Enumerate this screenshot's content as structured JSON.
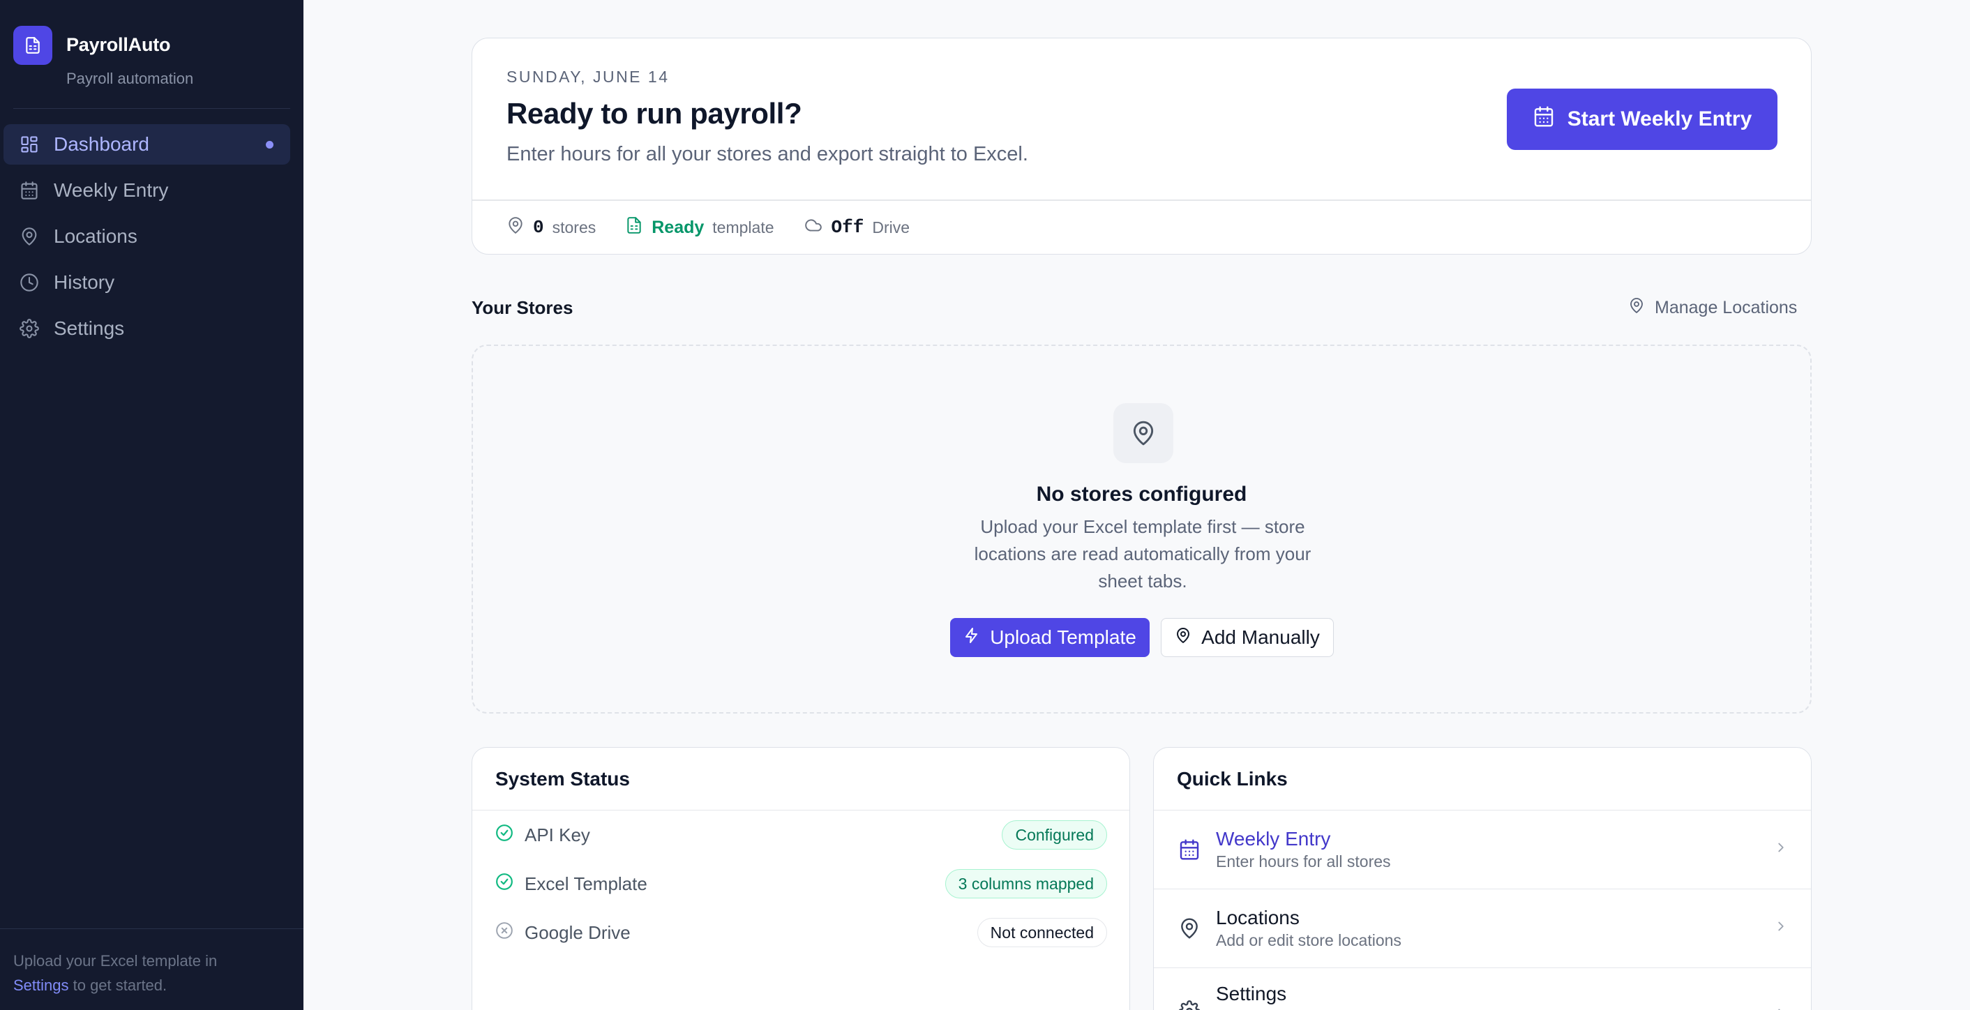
{
  "sidebar": {
    "brand_name": "PayrollAuto",
    "brand_sub": "Payroll automation",
    "items": [
      {
        "label": "Dashboard",
        "icon": "dashboard-icon",
        "active": true
      },
      {
        "label": "Weekly Entry",
        "icon": "calendar-icon"
      },
      {
        "label": "Locations",
        "icon": "map-pin-icon"
      },
      {
        "label": "History",
        "icon": "clock-icon"
      },
      {
        "label": "Settings",
        "icon": "gear-icon"
      }
    ],
    "footer": {
      "before": "Upload your Excel template in",
      "link": "Settings",
      "after": " to get started."
    }
  },
  "hero": {
    "date": "SUNDAY, JUNE 14",
    "title": "Ready to run payroll?",
    "subtitle": "Enter hours for all your stores and export straight to Excel.",
    "cta_label": "Start Weekly Entry",
    "stats": {
      "stores_value": "0",
      "stores_label": "stores",
      "template_value": "Ready",
      "template_label": "template",
      "drive_value": "Off",
      "drive_label": "Drive"
    }
  },
  "stores": {
    "title": "Your Stores",
    "manage_label": "Manage Locations",
    "empty_title": "No stores configured",
    "empty_desc": "Upload your Excel template first — store locations are read automatically from your sheet tabs.",
    "upload_label": "Upload Template",
    "add_label": "Add Manually"
  },
  "system_status": {
    "title": "System Status",
    "rows": [
      {
        "label": "API Key",
        "badge": "Configured",
        "state": "ok"
      },
      {
        "label": "Excel Template",
        "badge": "3 columns mapped",
        "state": "ok"
      },
      {
        "label": "Google Drive",
        "badge": "Not connected",
        "state": "off"
      }
    ]
  },
  "quick_links": {
    "title": "Quick Links",
    "items": [
      {
        "title": "Weekly Entry",
        "desc": "Enter hours for all stores",
        "icon": "calendar-icon"
      },
      {
        "title": "Locations",
        "desc": "Add or edit store locations",
        "icon": "map-pin-icon"
      },
      {
        "title": "Settings",
        "desc": "",
        "icon": "gear-icon"
      }
    ]
  },
  "colors": {
    "accent": "#4f46e5",
    "sidebar_bg": "#141a2e",
    "success": "#059669"
  }
}
